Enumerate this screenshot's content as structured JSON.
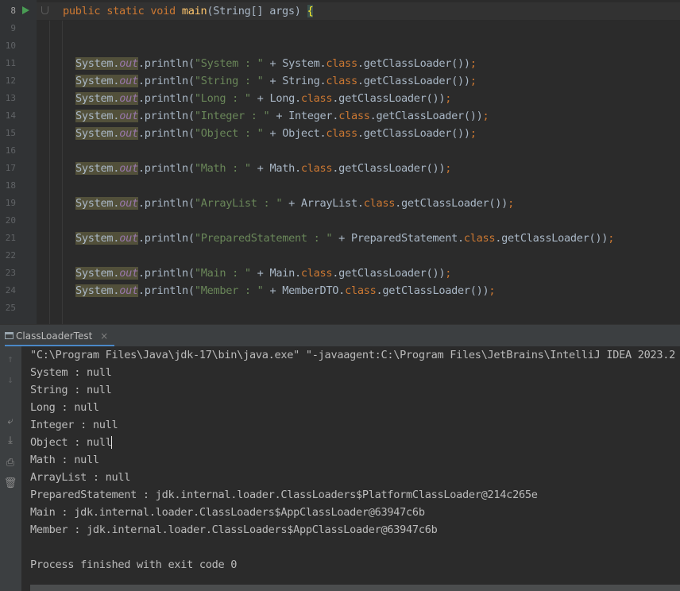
{
  "editor": {
    "lines": [
      {
        "num": "8",
        "code": [
          "kw:public static void ",
          "fn:main",
          "pl:(String[] args) ",
          "brc:{"
        ]
      },
      {
        "num": "9",
        "code": []
      },
      {
        "num": "10",
        "code": []
      },
      {
        "num": "11",
        "code": [
          "out",
          "pl:.println(",
          "str:\"System : \"",
          "pl: + System.",
          "kw:class",
          "pl:.getClassLoader())",
          "kw:;"
        ]
      },
      {
        "num": "12",
        "code": [
          "out",
          "pl:.println(",
          "str:\"String : \"",
          "pl: + String.",
          "kw:class",
          "pl:.getClassLoader())",
          "kw:;"
        ]
      },
      {
        "num": "13",
        "code": [
          "out",
          "pl:.println(",
          "str:\"Long : \"",
          "pl: + Long.",
          "kw:class",
          "pl:.getClassLoader())",
          "kw:;"
        ]
      },
      {
        "num": "14",
        "code": [
          "out",
          "pl:.println(",
          "str:\"Integer : \"",
          "pl: + Integer.",
          "kw:class",
          "pl:.getClassLoader())",
          "kw:;"
        ]
      },
      {
        "num": "15",
        "code": [
          "out",
          "pl:.println(",
          "str:\"Object : \"",
          "pl: + Object.",
          "kw:class",
          "pl:.getClassLoader())",
          "kw:;"
        ]
      },
      {
        "num": "16",
        "code": []
      },
      {
        "num": "17",
        "code": [
          "out",
          "pl:.println(",
          "str:\"Math : \"",
          "pl: + Math.",
          "kw:class",
          "pl:.getClassLoader())",
          "kw:;"
        ]
      },
      {
        "num": "18",
        "code": []
      },
      {
        "num": "19",
        "code": [
          "out",
          "pl:.println(",
          "str:\"ArrayList : \"",
          "pl: + ArrayList.",
          "kw:class",
          "pl:.getClassLoader())",
          "kw:;"
        ]
      },
      {
        "num": "20",
        "code": []
      },
      {
        "num": "21",
        "code": [
          "out",
          "pl:.println(",
          "str:\"PreparedStatement : \"",
          "pl: + PreparedStatement.",
          "kw:class",
          "pl:.getClassLoader())",
          "kw:;"
        ]
      },
      {
        "num": "22",
        "code": []
      },
      {
        "num": "23",
        "code": [
          "out",
          "pl:.println(",
          "str:\"Main : \"",
          "pl: + Main.",
          "kw:class",
          "pl:.getClassLoader())",
          "kw:;"
        ]
      },
      {
        "num": "24",
        "code": [
          "out",
          "pl:.println(",
          "str:\"Member : \"",
          "pl: + MemberDTO.",
          "kw:class",
          "pl:.getClassLoader())",
          "kw:;"
        ]
      },
      {
        "num": "25",
        "code": []
      }
    ],
    "sys_prefix": "System.",
    "out_field": "out"
  },
  "run_panel": {
    "tab_label": "ClassLoaderTest",
    "tab_close": "×",
    "tools": [
      {
        "icon": "arrow-up-icon",
        "glyph": "↑",
        "dim": true
      },
      {
        "icon": "arrow-down-icon",
        "glyph": "↓",
        "dim": true
      },
      {
        "icon": "soft-wrap-icon",
        "glyph": "⤶",
        "dim": false
      },
      {
        "icon": "scroll-to-end-icon",
        "glyph": "⤓",
        "dim": false
      },
      {
        "icon": "print-icon",
        "glyph": "⎙",
        "dim": false
      },
      {
        "icon": "trash-icon",
        "glyph": "🗑",
        "dim": false
      }
    ],
    "console_lines": [
      "\"C:\\Program Files\\Java\\jdk-17\\bin\\java.exe\" \"-javaagent:C:\\Program Files\\JetBrains\\IntelliJ IDEA 2023.2",
      "System : null",
      "String : null",
      "Long : null",
      "Integer : null",
      "Object : null",
      "Math : null",
      "ArrayList : null",
      "PreparedStatement : jdk.internal.loader.ClassLoaders$PlatformClassLoader@214c265e",
      "Main : jdk.internal.loader.ClassLoaders$AppClassLoader@63947c6b",
      "Member : jdk.internal.loader.ClassLoaders$AppClassLoader@63947c6b",
      "",
      "Process finished with exit code 0"
    ]
  }
}
